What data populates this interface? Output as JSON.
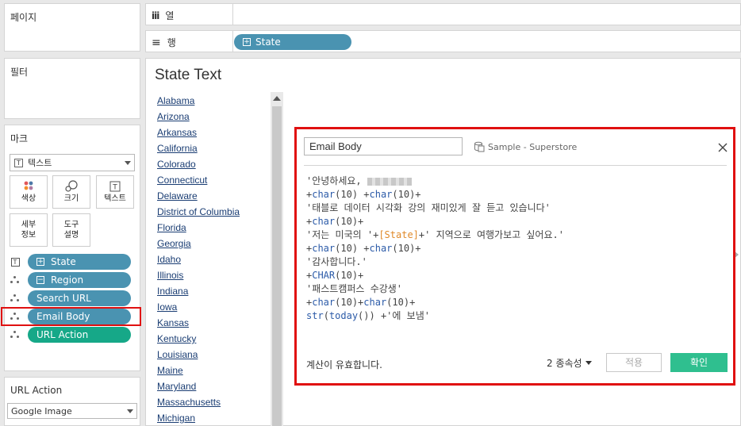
{
  "left_panel": {
    "pages_title": "페이지",
    "filters_title": "필터",
    "marks": {
      "title": "마크",
      "type_label": "텍스트",
      "buttons": {
        "color": "색상",
        "size": "크기",
        "text": "텍스트",
        "detail_line1": "세부",
        "detail_line2": "정보",
        "tooltip_line1": "도구",
        "tooltip_line2": "설명"
      },
      "fields": [
        {
          "label": "State"
        },
        {
          "label": "Region"
        },
        {
          "label": "Search URL"
        },
        {
          "label": "Email Body"
        },
        {
          "label": "URL Action"
        }
      ]
    },
    "url_action": {
      "title": "URL Action",
      "selected": "Google Image"
    }
  },
  "shelves": {
    "columns_icon": "iii",
    "columns_label": "열",
    "rows_icon": "≡",
    "rows_label": "행",
    "rows_pill": "State"
  },
  "worksheet": {
    "title": "State Text",
    "states": [
      "Alabama",
      "Arizona",
      "Arkansas",
      "California",
      "Colorado",
      "Connecticut",
      "Delaware",
      "District of Columbia",
      "Florida",
      "Georgia",
      "Idaho",
      "Illinois",
      "Indiana",
      "Iowa",
      "Kansas",
      "Kentucky",
      "Louisiana",
      "Maine",
      "Maryland",
      "Massachusetts",
      "Michigan"
    ]
  },
  "calc_dialog": {
    "name": "Email Body",
    "datasource": "Sample - Superstore",
    "code": {
      "l1": "'안녕하세요, ",
      "l2_kw1": "char",
      "l2_a": "(10) +",
      "l2_kw2": "char",
      "l2_b": "(10)+",
      "l3": "'태블로 데이터 시각화 강의 재미있게 잘 듣고 있습니다'",
      "l4_kw": "char",
      "l4_a": "(10)+",
      "l5_a": "'저는 미국의 '+",
      "l5_field": "[State]",
      "l5_b": "+' 지역으로 여행가보고 싶어요.'",
      "l6_kw1": "char",
      "l6_a": "(10) +",
      "l6_kw2": "char",
      "l6_b": "(10)+",
      "l7": "'감사합니다.'",
      "l8_kw": "CHAR",
      "l8_a": "(10)+",
      "l9": "'패스트캠퍼스 수강생'",
      "l10_kw1": "char",
      "l10_a": "(10)+",
      "l10_kw2": "char",
      "l10_b": "(10)+",
      "l11_kw1": "str",
      "l11_a": "(",
      "l11_kw2": "today",
      "l11_b": "()) +'에 보냄'"
    },
    "status": "계산이 유효합니다.",
    "dependencies": "2 종속성",
    "apply_label": "적용",
    "ok_label": "확인"
  }
}
